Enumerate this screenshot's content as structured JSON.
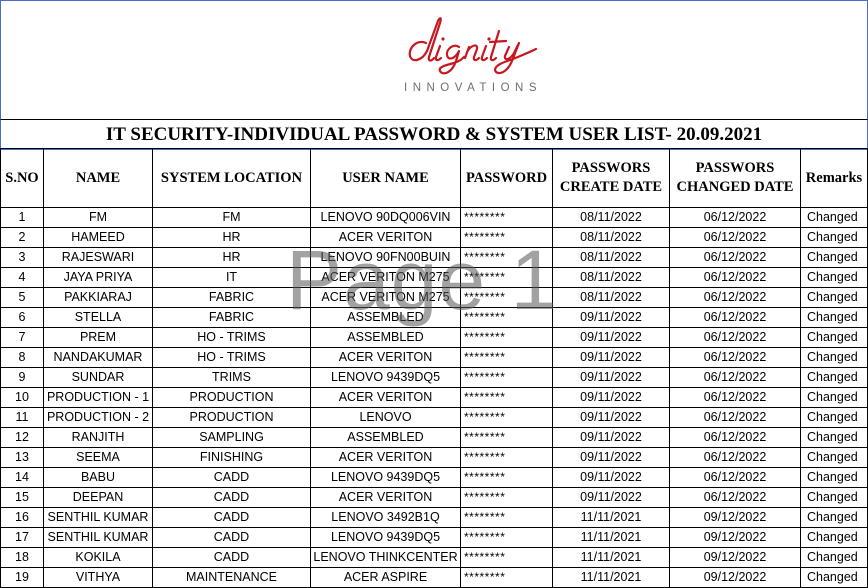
{
  "logo": {
    "wordmark": "dignity",
    "tagline": "INNOVATIONS",
    "color": "#c8171e"
  },
  "document": {
    "title": "IT SECURITY-INDIVIDUAL PASSWORD & SYSTEM USER LIST- 20.09.2021",
    "watermark": "Page 1"
  },
  "table": {
    "headers": {
      "sno": "S.NO",
      "name": "NAME",
      "location": "SYSTEM LOCATION",
      "user": "USER NAME",
      "password": "PASSWORD",
      "create_1": "PASSWORS",
      "create_2": "CREATE DATE",
      "changed_1": "PASSWORS",
      "changed_2": "CHANGED DATE",
      "remarks": "Remarks"
    },
    "rows": [
      {
        "sno": "1",
        "name": "FM",
        "location": "FM",
        "user": "LENOVO 90DQ006VIN",
        "password": "********",
        "create": "08/11/2022",
        "changed": "06/12/2022",
        "remarks": "Changed"
      },
      {
        "sno": "2",
        "name": "HAMEED",
        "location": "HR",
        "user": "ACER VERITON",
        "password": "********",
        "create": "08/11/2022",
        "changed": "06/12/2022",
        "remarks": "Changed"
      },
      {
        "sno": "3",
        "name": "RAJESWARI",
        "location": "HR",
        "user": "LENOVO 90FN00BUIN",
        "password": "********",
        "create": "08/11/2022",
        "changed": "06/12/2022",
        "remarks": "Changed"
      },
      {
        "sno": "4",
        "name": "JAYA PRIYA",
        "location": "IT",
        "user": "ACER VERITON M275",
        "password": "********",
        "create": "08/11/2022",
        "changed": "06/12/2022",
        "remarks": "Changed"
      },
      {
        "sno": "5",
        "name": "PAKKIARAJ",
        "location": "FABRIC",
        "user": "ACER VERITON M275",
        "password": "********",
        "create": "08/11/2022",
        "changed": "06/12/2022",
        "remarks": "Changed"
      },
      {
        "sno": "6",
        "name": "STELLA",
        "location": "FABRIC",
        "user": "ASSEMBLED",
        "password": "********",
        "create": "09/11/2022",
        "changed": "06/12/2022",
        "remarks": "Changed"
      },
      {
        "sno": "7",
        "name": "PREM",
        "location": "HO - TRIMS",
        "user": "ASSEMBLED",
        "password": "********",
        "create": "09/11/2022",
        "changed": "06/12/2022",
        "remarks": "Changed"
      },
      {
        "sno": "8",
        "name": "NANDAKUMAR",
        "location": "HO - TRIMS",
        "user": "ACER VERITON",
        "password": "********",
        "create": "09/11/2022",
        "changed": "06/12/2022",
        "remarks": "Changed"
      },
      {
        "sno": "9",
        "name": "SUNDAR",
        "location": "TRIMS",
        "user": "LENOVO 9439DQ5",
        "password": "********",
        "create": "09/11/2022",
        "changed": "06/12/2022",
        "remarks": "Changed"
      },
      {
        "sno": "10",
        "name": "PRODUCTION - 1",
        "location": "PRODUCTION",
        "user": "ACER VERITON",
        "password": "********",
        "create": "09/11/2022",
        "changed": "06/12/2022",
        "remarks": "Changed"
      },
      {
        "sno": "11",
        "name": "PRODUCTION - 2",
        "location": "PRODUCTION",
        "user": "LENOVO",
        "password": "********",
        "create": "09/11/2022",
        "changed": "06/12/2022",
        "remarks": "Changed"
      },
      {
        "sno": "12",
        "name": "RANJITH",
        "location": "SAMPLING",
        "user": "ASSEMBLED",
        "password": "********",
        "create": "09/11/2022",
        "changed": "06/12/2022",
        "remarks": "Changed"
      },
      {
        "sno": "13",
        "name": "SEEMA",
        "location": "FINISHING",
        "user": "ACER VERITON",
        "password": "********",
        "create": "09/11/2022",
        "changed": "06/12/2022",
        "remarks": "Changed"
      },
      {
        "sno": "14",
        "name": "BABU",
        "location": "CADD",
        "user": "LENOVO 9439DQ5",
        "password": "********",
        "create": "09/11/2022",
        "changed": "06/12/2022",
        "remarks": "Changed"
      },
      {
        "sno": "15",
        "name": "DEEPAN",
        "location": "CADD",
        "user": "ACER VERITON",
        "password": "********",
        "create": "09/11/2022",
        "changed": "06/12/2022",
        "remarks": "Changed"
      },
      {
        "sno": "16",
        "name": "SENTHIL KUMAR",
        "location": "CADD",
        "user": "LENOVO 3492B1Q",
        "password": "********",
        "create": "11/11/2021",
        "changed": "09/12/2022",
        "remarks": "Changed"
      },
      {
        "sno": "17",
        "name": "SENTHIL KUMAR",
        "location": "CADD",
        "user": "LENOVO 9439DQ5",
        "password": "********",
        "create": "11/11/2021",
        "changed": "09/12/2022",
        "remarks": "Changed"
      },
      {
        "sno": "18",
        "name": "KOKILA",
        "location": "CADD",
        "user": "LENOVO THINKCENTER",
        "password": "********",
        "create": "11/11/2021",
        "changed": "09/12/2022",
        "remarks": "Changed"
      },
      {
        "sno": "19",
        "name": "VITHYA",
        "location": "MAINTENANCE",
        "user": "ACER ASPIRE",
        "password": "********",
        "create": "11/11/2021",
        "changed": "09/12/2022",
        "remarks": "Changed"
      }
    ]
  }
}
